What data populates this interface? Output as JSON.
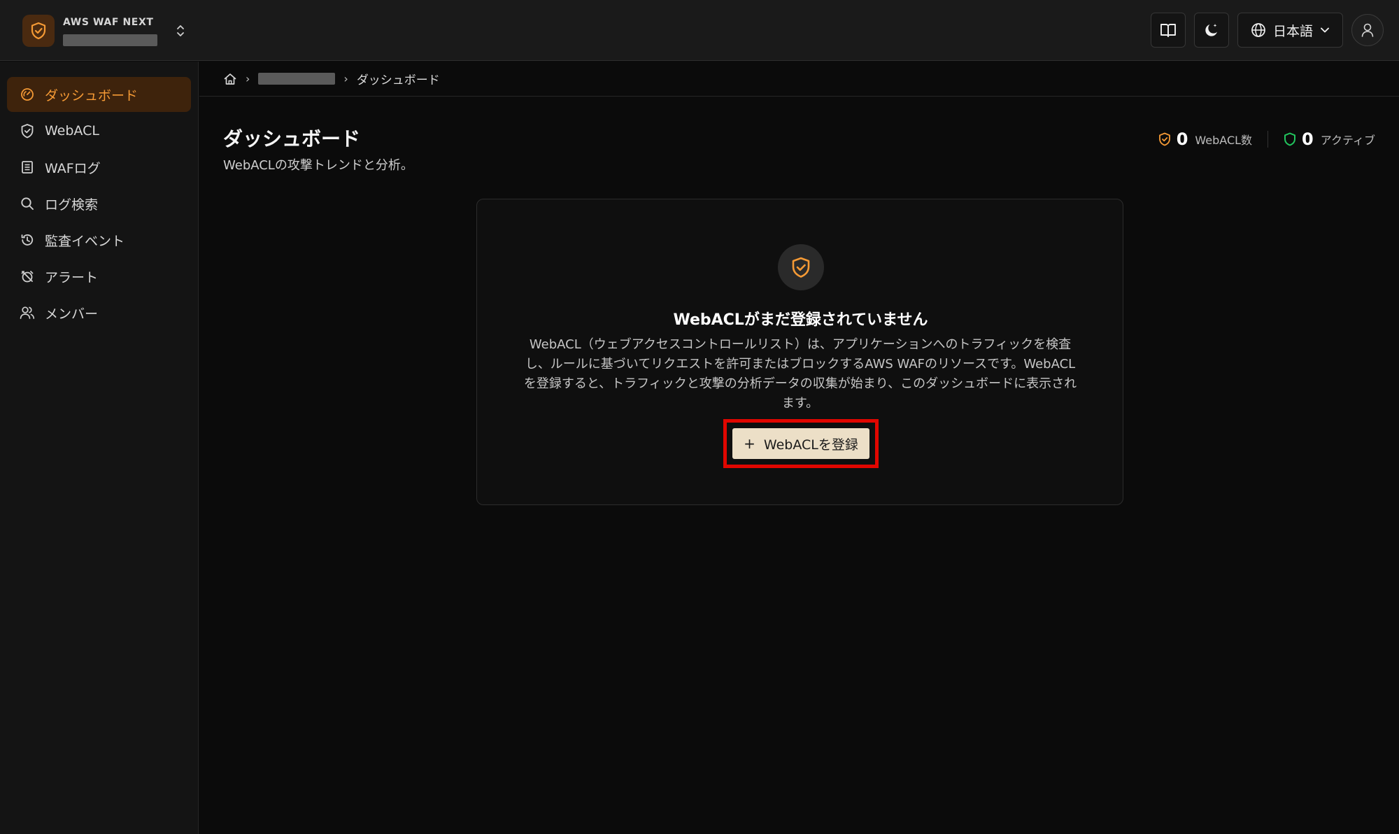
{
  "header": {
    "brand_name": "AWS WAF NEXT",
    "language_label": "日本語"
  },
  "sidebar": {
    "items": [
      {
        "label": "ダッシュボード",
        "icon": "gauge-icon",
        "active": true
      },
      {
        "label": "WebACL",
        "icon": "shield-check-icon",
        "active": false
      },
      {
        "label": "WAFログ",
        "icon": "log-list-icon",
        "active": false
      },
      {
        "label": "ログ検索",
        "icon": "search-icon",
        "active": false
      },
      {
        "label": "監査イベント",
        "icon": "history-icon",
        "active": false
      },
      {
        "label": "アラート",
        "icon": "alarm-off-icon",
        "active": false
      },
      {
        "label": "メンバー",
        "icon": "users-icon",
        "active": false
      }
    ]
  },
  "breadcrumb": {
    "current": "ダッシュボード"
  },
  "page": {
    "title": "ダッシュボード",
    "subtitle": "WebACLの攻撃トレンドと分析。"
  },
  "stats": {
    "webacl_count": "0",
    "webacl_label": "WebACL数",
    "active_count": "0",
    "active_label": "アクティブ"
  },
  "empty_state": {
    "title": "WebACLがまだ登録されていません",
    "description": "WebACL（ウェブアクセスコントロールリスト）は、アプリケーションへのトラフィックを検査し、ルールに基づいてリクエストを許可またはブロックするAWS WAFのリソースです。WebACLを登録すると、トラフィックと攻撃の分析データの収集が始まり、このダッシュボードに表示されます。",
    "button_label": "WebACLを登録",
    "button_plus": "+"
  },
  "colors": {
    "accent": "#f59a35",
    "active_green": "#22c55e",
    "highlight_box": "#e10600"
  }
}
